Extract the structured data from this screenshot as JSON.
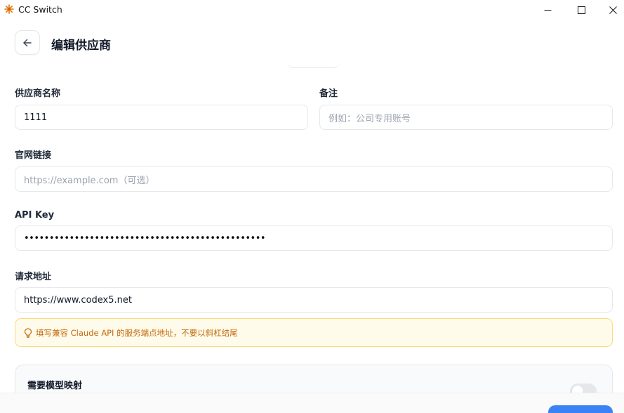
{
  "window": {
    "title": "CC Switch",
    "logo_color": "#d97706"
  },
  "header": {
    "title": "编辑供应商"
  },
  "form": {
    "name": {
      "label": "供应商名称",
      "value": "1111"
    },
    "notes": {
      "label": "备注",
      "placeholder": "例如：公司专用账号"
    },
    "website": {
      "label": "官网链接",
      "placeholder": "https://example.com（可选）"
    },
    "api_key": {
      "label": "API Key",
      "masked_value": "••••••••••••••••••••••••••••••••••••••••••••••••"
    },
    "endpoint": {
      "label": "请求地址",
      "value": "https://www.codex5.net"
    }
  },
  "hint": {
    "text": "填写兼容 Claude API 的服务端点地址，不要以斜杠结尾",
    "icon": "lightbulb-icon",
    "color": "#c2690b"
  },
  "model_mapping": {
    "title": "需要模型映射",
    "enabled": false
  },
  "colors": {
    "accent": "#3b82f6",
    "hint_bg": "#fffbeb",
    "hint_border": "#fcd97a"
  }
}
